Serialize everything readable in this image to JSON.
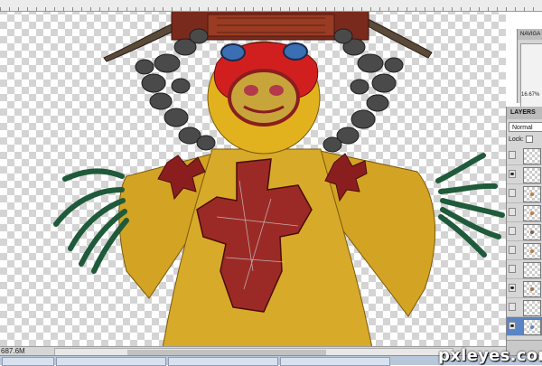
{
  "navigator": {
    "tab_label": "NAVIGA",
    "zoom": "16.67%"
  },
  "layers": {
    "tab_label": "LAYERS",
    "blend_mode": "Normal",
    "lock_label": "Lock:",
    "rows": [
      {
        "visible": false,
        "thumb_color": ""
      },
      {
        "visible": true,
        "thumb_color": ""
      },
      {
        "visible": false,
        "thumb_color": "#c57a3a"
      },
      {
        "visible": false,
        "thumb_color": "#c57a3a"
      },
      {
        "visible": false,
        "thumb_color": "#8a5a3a"
      },
      {
        "visible": false,
        "thumb_color": "#c57a3a"
      },
      {
        "visible": false,
        "thumb_color": ""
      },
      {
        "visible": true,
        "thumb_color": "#a07040"
      },
      {
        "visible": false,
        "thumb_color": ""
      },
      {
        "visible": true,
        "thumb_color": "#5b84c4",
        "selected": true
      }
    ]
  },
  "status": {
    "doc_size": "687.6M"
  },
  "watermark": "pxleyes.com"
}
